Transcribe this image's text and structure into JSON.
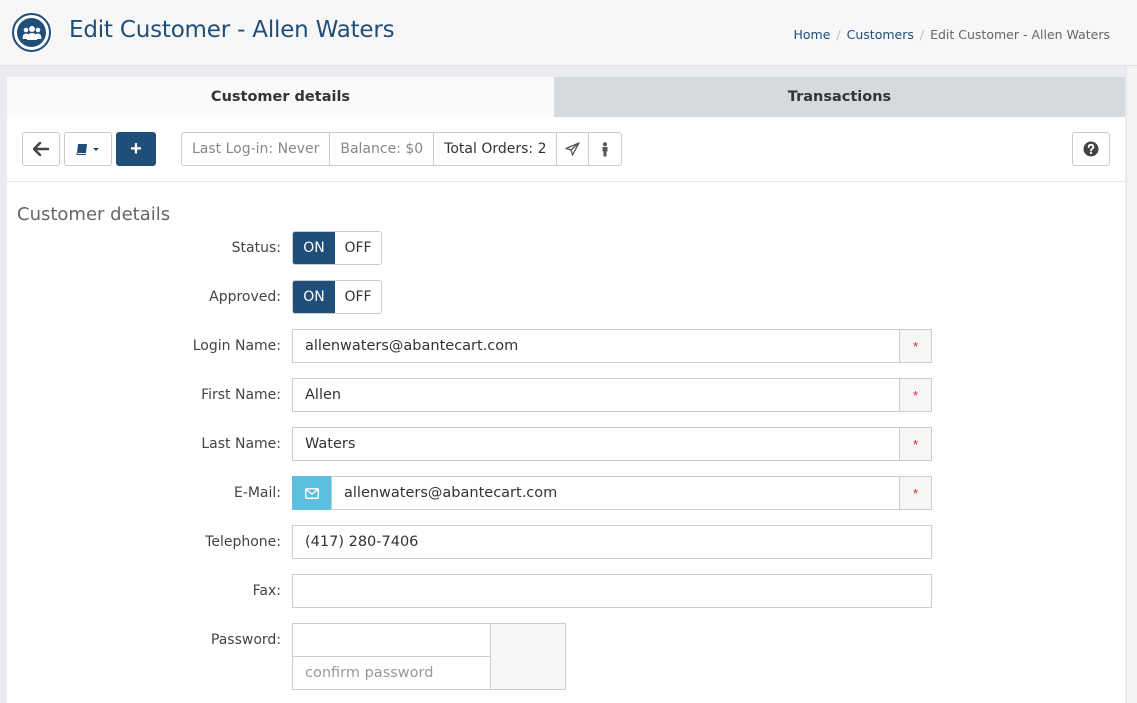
{
  "header": {
    "title": "Edit Customer - Allen Waters",
    "icon": "customers-group-icon",
    "accent": "#1f4e79"
  },
  "breadcrumb": {
    "home": "Home",
    "customers": "Customers",
    "current": "Edit Customer - Allen Waters"
  },
  "tabs": {
    "details": "Customer details",
    "transactions": "Transactions"
  },
  "toolbar": {
    "back_icon": "arrow-left-icon",
    "book_icon": "book-dropdown-icon",
    "add_label": "+",
    "last_login": "Last Log-in: Never",
    "balance": "Balance: $0",
    "total_orders": "Total Orders: 2",
    "send_icon": "paper-plane-icon",
    "person_icon": "person-icon",
    "help_icon": "question-circle-icon"
  },
  "form": {
    "section_title": "Customer details",
    "status": {
      "label": "Status:",
      "on": "ON",
      "off": "OFF",
      "value": "ON"
    },
    "approved": {
      "label": "Approved:",
      "on": "ON",
      "off": "OFF",
      "value": "ON"
    },
    "login_name": {
      "label": "Login Name:",
      "value": "allenwaters@abantecart.com",
      "required": "*"
    },
    "first_name": {
      "label": "First Name:",
      "value": "Allen",
      "required": "*"
    },
    "last_name": {
      "label": "Last Name:",
      "value": "Waters",
      "required": "*"
    },
    "email": {
      "label": "E-Mail:",
      "value": "allenwaters@abantecart.com",
      "required": "*"
    },
    "telephone": {
      "label": "Telephone:",
      "value": "(417) 280-7406"
    },
    "fax": {
      "label": "Fax:",
      "value": ""
    },
    "password": {
      "label": "Password:",
      "value": "",
      "confirm_placeholder": "confirm password"
    }
  },
  "colors": {
    "primary": "#1f4e79",
    "email_addon": "#5bc0de",
    "required": "#d9232d"
  }
}
